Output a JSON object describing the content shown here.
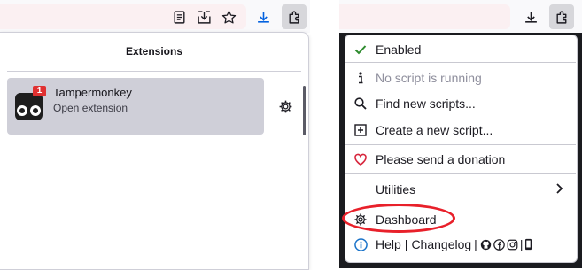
{
  "left_window": {
    "toolbar": {
      "reader_icon": "reader-view-icon",
      "download_page_icon": "save-download-icon",
      "bookmark_icon": "star-icon",
      "downloads_icon": "download-arrow-icon",
      "extensions_icon": "puzzle-icon"
    },
    "panel": {
      "title": "Extensions",
      "extension": {
        "name": "Tampermonkey",
        "subtitle": "Open extension",
        "badge": "1",
        "settings_icon": "gear-icon"
      }
    }
  },
  "right_window": {
    "toolbar": {
      "downloads_icon": "download-arrow-icon",
      "extensions_icon": "puzzle-icon"
    },
    "menu": {
      "enabled": {
        "label": "Enabled",
        "icon": "checkmark-icon"
      },
      "no_script": {
        "label": "No script is running",
        "icon": "info-icon"
      },
      "find_scripts": {
        "label": "Find new scripts...",
        "icon": "search-icon"
      },
      "create_script": {
        "label": "Create a new script...",
        "icon": "plus-square-icon"
      },
      "donation": {
        "label": "Please send a donation",
        "icon": "heart-icon"
      },
      "utilities": {
        "label": "Utilities",
        "icon": "chevron-right-icon"
      },
      "dashboard": {
        "label": "Dashboard",
        "icon": "gear-icon"
      },
      "help_line": {
        "help": "Help",
        "separator": "|",
        "changelog": "Changelog"
      }
    }
  },
  "colors": {
    "accent_blue": "#0060df",
    "check_green": "#2e8b2e",
    "heart_red": "#d7263d",
    "highlight_red": "#e8202a",
    "menu_dark_bg": "#1a1b1f"
  }
}
